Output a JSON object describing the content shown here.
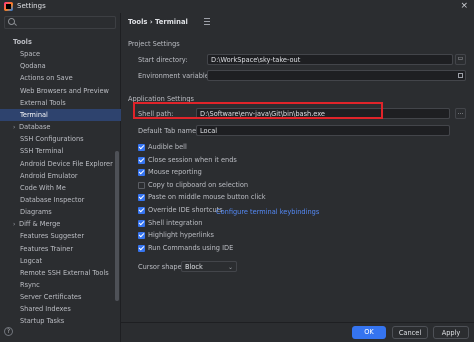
{
  "window": {
    "title": "Settings",
    "close_glyph": "×"
  },
  "breadcrumb": {
    "parent": "Tools",
    "separator": "›",
    "current": "Terminal"
  },
  "sidebar": {
    "items": [
      {
        "label": "Tools",
        "arrow": ""
      },
      {
        "label": "Space",
        "arrow": ""
      },
      {
        "label": "Qodana",
        "arrow": ""
      },
      {
        "label": "Actions on Save",
        "arrow": ""
      },
      {
        "label": "Web Browsers and Preview",
        "arrow": ""
      },
      {
        "label": "External Tools",
        "arrow": ""
      },
      {
        "label": "Terminal",
        "arrow": ""
      },
      {
        "label": "Database",
        "arrow": "›"
      },
      {
        "label": "SSH Configurations",
        "arrow": ""
      },
      {
        "label": "SSH Terminal",
        "arrow": ""
      },
      {
        "label": "Android Device File Explorer",
        "arrow": ""
      },
      {
        "label": "Android Emulator",
        "arrow": ""
      },
      {
        "label": "Code With Me",
        "arrow": ""
      },
      {
        "label": "Database Inspector",
        "arrow": ""
      },
      {
        "label": "Diagrams",
        "arrow": ""
      },
      {
        "label": "Diff & Merge",
        "arrow": "›"
      },
      {
        "label": "Features Suggester",
        "arrow": ""
      },
      {
        "label": "Features Trainer",
        "arrow": ""
      },
      {
        "label": "Logcat",
        "arrow": ""
      },
      {
        "label": "Remote SSH External Tools",
        "arrow": ""
      },
      {
        "label": "Rsync",
        "arrow": ""
      },
      {
        "label": "Server Certificates",
        "arrow": ""
      },
      {
        "label": "Shared Indexes",
        "arrow": ""
      },
      {
        "label": "Startup Tasks",
        "arrow": ""
      }
    ]
  },
  "project_settings": {
    "heading": "Project Settings",
    "start_directory_label": "Start directory:",
    "start_directory_value": "D:\\WorkSpace\\sky-take-out",
    "env_vars_label": "Environment variables:",
    "env_vars_value": ""
  },
  "application_settings": {
    "heading": "Application Settings",
    "shell_path_label": "Shell path:",
    "shell_path_value": "D:\\Software\\env-java\\Git\\bin\\bash.exe",
    "default_tab_label": "Default Tab name:",
    "default_tab_value": "Local",
    "browse_glyph": "...",
    "checkboxes": [
      {
        "label": "Audible bell",
        "checked": true
      },
      {
        "label": "Close session when it ends",
        "checked": true
      },
      {
        "label": "Mouse reporting",
        "checked": true
      },
      {
        "label": "Copy to clipboard on selection",
        "checked": false
      },
      {
        "label": "Paste on middle mouse button click",
        "checked": true
      },
      {
        "label": "Override IDE shortcuts",
        "checked": true
      },
      {
        "label": "Shell integration",
        "checked": true
      },
      {
        "label": "Highlight hyperlinks",
        "checked": true
      },
      {
        "label": "Run Commands using IDE",
        "checked": true
      }
    ],
    "keybindings_link": "Configure terminal keybindings",
    "cursor_shape_label": "Cursor shape:",
    "cursor_shape_value": "Block"
  },
  "footer": {
    "ok_label": "OK",
    "cancel_label": "Cancel",
    "apply_label": "Apply",
    "help_glyph": "?"
  },
  "colors": {
    "accent": "#3574f0",
    "selection": "#2e436e",
    "highlight_box": "#e0242a",
    "link": "#548af7"
  }
}
